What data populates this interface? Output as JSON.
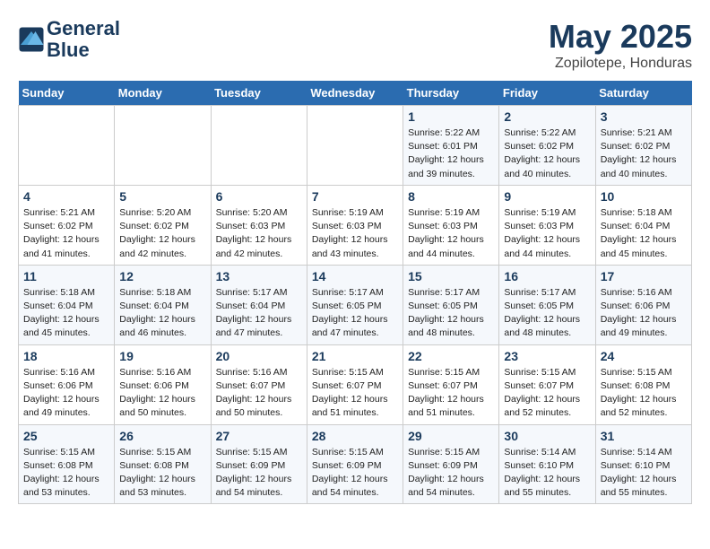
{
  "header": {
    "logo_line1": "General",
    "logo_line2": "Blue",
    "month": "May 2025",
    "location": "Zopilotepe, Honduras"
  },
  "weekdays": [
    "Sunday",
    "Monday",
    "Tuesday",
    "Wednesday",
    "Thursday",
    "Friday",
    "Saturday"
  ],
  "weeks": [
    [
      {
        "day": "",
        "info": ""
      },
      {
        "day": "",
        "info": ""
      },
      {
        "day": "",
        "info": ""
      },
      {
        "day": "",
        "info": ""
      },
      {
        "day": "1",
        "info": "Sunrise: 5:22 AM\nSunset: 6:01 PM\nDaylight: 12 hours\nand 39 minutes."
      },
      {
        "day": "2",
        "info": "Sunrise: 5:22 AM\nSunset: 6:02 PM\nDaylight: 12 hours\nand 40 minutes."
      },
      {
        "day": "3",
        "info": "Sunrise: 5:21 AM\nSunset: 6:02 PM\nDaylight: 12 hours\nand 40 minutes."
      }
    ],
    [
      {
        "day": "4",
        "info": "Sunrise: 5:21 AM\nSunset: 6:02 PM\nDaylight: 12 hours\nand 41 minutes."
      },
      {
        "day": "5",
        "info": "Sunrise: 5:20 AM\nSunset: 6:02 PM\nDaylight: 12 hours\nand 42 minutes."
      },
      {
        "day": "6",
        "info": "Sunrise: 5:20 AM\nSunset: 6:03 PM\nDaylight: 12 hours\nand 42 minutes."
      },
      {
        "day": "7",
        "info": "Sunrise: 5:19 AM\nSunset: 6:03 PM\nDaylight: 12 hours\nand 43 minutes."
      },
      {
        "day": "8",
        "info": "Sunrise: 5:19 AM\nSunset: 6:03 PM\nDaylight: 12 hours\nand 44 minutes."
      },
      {
        "day": "9",
        "info": "Sunrise: 5:19 AM\nSunset: 6:03 PM\nDaylight: 12 hours\nand 44 minutes."
      },
      {
        "day": "10",
        "info": "Sunrise: 5:18 AM\nSunset: 6:04 PM\nDaylight: 12 hours\nand 45 minutes."
      }
    ],
    [
      {
        "day": "11",
        "info": "Sunrise: 5:18 AM\nSunset: 6:04 PM\nDaylight: 12 hours\nand 45 minutes."
      },
      {
        "day": "12",
        "info": "Sunrise: 5:18 AM\nSunset: 6:04 PM\nDaylight: 12 hours\nand 46 minutes."
      },
      {
        "day": "13",
        "info": "Sunrise: 5:17 AM\nSunset: 6:04 PM\nDaylight: 12 hours\nand 47 minutes."
      },
      {
        "day": "14",
        "info": "Sunrise: 5:17 AM\nSunset: 6:05 PM\nDaylight: 12 hours\nand 47 minutes."
      },
      {
        "day": "15",
        "info": "Sunrise: 5:17 AM\nSunset: 6:05 PM\nDaylight: 12 hours\nand 48 minutes."
      },
      {
        "day": "16",
        "info": "Sunrise: 5:17 AM\nSunset: 6:05 PM\nDaylight: 12 hours\nand 48 minutes."
      },
      {
        "day": "17",
        "info": "Sunrise: 5:16 AM\nSunset: 6:06 PM\nDaylight: 12 hours\nand 49 minutes."
      }
    ],
    [
      {
        "day": "18",
        "info": "Sunrise: 5:16 AM\nSunset: 6:06 PM\nDaylight: 12 hours\nand 49 minutes."
      },
      {
        "day": "19",
        "info": "Sunrise: 5:16 AM\nSunset: 6:06 PM\nDaylight: 12 hours\nand 50 minutes."
      },
      {
        "day": "20",
        "info": "Sunrise: 5:16 AM\nSunset: 6:07 PM\nDaylight: 12 hours\nand 50 minutes."
      },
      {
        "day": "21",
        "info": "Sunrise: 5:15 AM\nSunset: 6:07 PM\nDaylight: 12 hours\nand 51 minutes."
      },
      {
        "day": "22",
        "info": "Sunrise: 5:15 AM\nSunset: 6:07 PM\nDaylight: 12 hours\nand 51 minutes."
      },
      {
        "day": "23",
        "info": "Sunrise: 5:15 AM\nSunset: 6:07 PM\nDaylight: 12 hours\nand 52 minutes."
      },
      {
        "day": "24",
        "info": "Sunrise: 5:15 AM\nSunset: 6:08 PM\nDaylight: 12 hours\nand 52 minutes."
      }
    ],
    [
      {
        "day": "25",
        "info": "Sunrise: 5:15 AM\nSunset: 6:08 PM\nDaylight: 12 hours\nand 53 minutes."
      },
      {
        "day": "26",
        "info": "Sunrise: 5:15 AM\nSunset: 6:08 PM\nDaylight: 12 hours\nand 53 minutes."
      },
      {
        "day": "27",
        "info": "Sunrise: 5:15 AM\nSunset: 6:09 PM\nDaylight: 12 hours\nand 54 minutes."
      },
      {
        "day": "28",
        "info": "Sunrise: 5:15 AM\nSunset: 6:09 PM\nDaylight: 12 hours\nand 54 minutes."
      },
      {
        "day": "29",
        "info": "Sunrise: 5:15 AM\nSunset: 6:09 PM\nDaylight: 12 hours\nand 54 minutes."
      },
      {
        "day": "30",
        "info": "Sunrise: 5:14 AM\nSunset: 6:10 PM\nDaylight: 12 hours\nand 55 minutes."
      },
      {
        "day": "31",
        "info": "Sunrise: 5:14 AM\nSunset: 6:10 PM\nDaylight: 12 hours\nand 55 minutes."
      }
    ]
  ]
}
